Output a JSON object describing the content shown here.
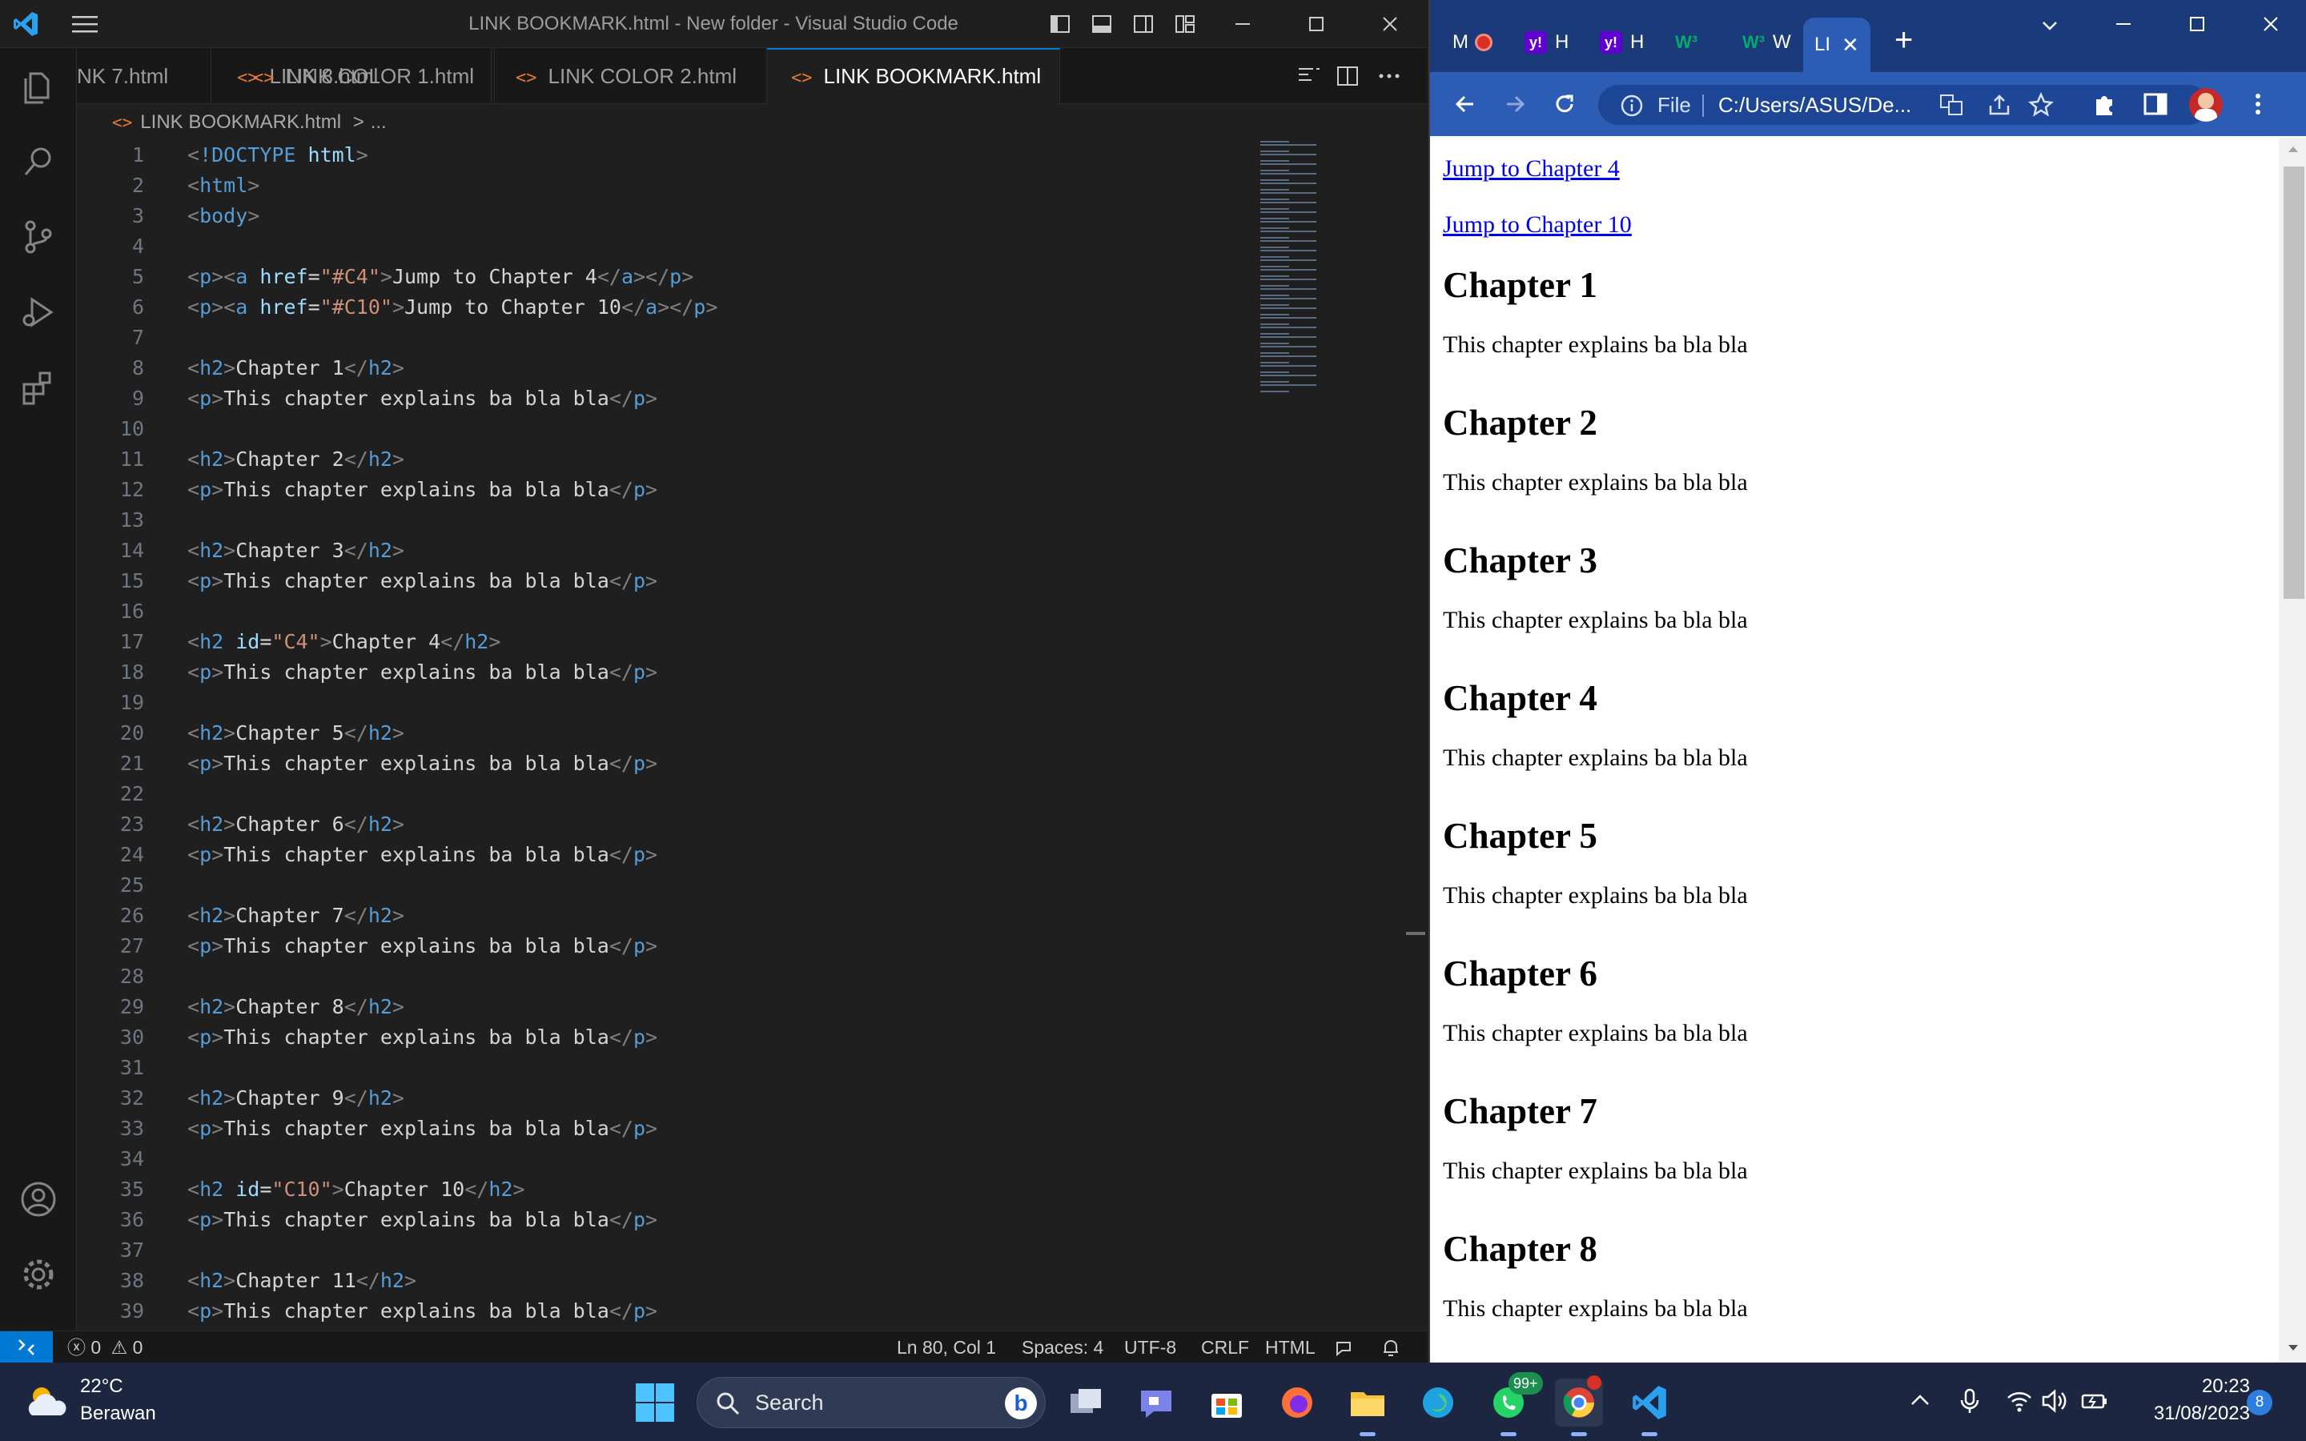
{
  "vscode": {
    "title": "LINK BOOKMARK.html - New folder - Visual Studio Code",
    "tabs": [
      {
        "label": "NK 7.html",
        "icon": "<>"
      },
      {
        "label": "LINK 8.html",
        "icon": "<>"
      },
      {
        "label": "LINK COLOR 1.html",
        "icon": "<>"
      },
      {
        "label": "LINK COLOR 2.html",
        "icon": "<>"
      },
      {
        "label": "LINK BOOKMARK.html",
        "icon": "<>",
        "active": true
      }
    ],
    "breadcrumb": {
      "file": "LINK BOOKMARK.html",
      "separator": ">",
      "rest": "..."
    },
    "code_lines": [
      {
        "n": "1",
        "tokens": [
          [
            "punc",
            "<"
          ],
          [
            "kw",
            "!DOCTYPE "
          ],
          [
            "attr",
            "html"
          ],
          [
            "punc",
            ">"
          ]
        ]
      },
      {
        "n": "2",
        "tokens": [
          [
            "punc",
            "<"
          ],
          [
            "tag",
            "html"
          ],
          [
            "punc",
            ">"
          ]
        ]
      },
      {
        "n": "3",
        "tokens": [
          [
            "punc",
            "<"
          ],
          [
            "tag",
            "body"
          ],
          [
            "punc",
            ">"
          ]
        ]
      },
      {
        "n": "4",
        "tokens": []
      },
      {
        "n": "5",
        "tokens": [
          [
            "punc",
            "<"
          ],
          [
            "tag",
            "p"
          ],
          [
            "punc",
            "><"
          ],
          [
            "tag",
            "a "
          ],
          [
            "attr",
            "href"
          ],
          [
            "text",
            "="
          ],
          [
            "str",
            "\"#C4\""
          ],
          [
            "punc",
            ">"
          ],
          [
            "text",
            "Jump to Chapter 4"
          ],
          [
            "punc",
            "</"
          ],
          [
            "tag",
            "a"
          ],
          [
            "punc",
            "></"
          ],
          [
            "tag",
            "p"
          ],
          [
            "punc",
            ">"
          ]
        ]
      },
      {
        "n": "6",
        "tokens": [
          [
            "punc",
            "<"
          ],
          [
            "tag",
            "p"
          ],
          [
            "punc",
            "><"
          ],
          [
            "tag",
            "a "
          ],
          [
            "attr",
            "href"
          ],
          [
            "text",
            "="
          ],
          [
            "str",
            "\"#C10\""
          ],
          [
            "punc",
            ">"
          ],
          [
            "text",
            "Jump to Chapter 10"
          ],
          [
            "punc",
            "</"
          ],
          [
            "tag",
            "a"
          ],
          [
            "punc",
            "></"
          ],
          [
            "tag",
            "p"
          ],
          [
            "punc",
            ">"
          ]
        ]
      },
      {
        "n": "7",
        "tokens": []
      },
      {
        "n": "8",
        "tokens": [
          [
            "punc",
            "<"
          ],
          [
            "tag",
            "h2"
          ],
          [
            "punc",
            ">"
          ],
          [
            "text",
            "Chapter 1"
          ],
          [
            "punc",
            "</"
          ],
          [
            "tag",
            "h2"
          ],
          [
            "punc",
            ">"
          ]
        ]
      },
      {
        "n": "9",
        "tokens": [
          [
            "punc",
            "<"
          ],
          [
            "tag",
            "p"
          ],
          [
            "punc",
            ">"
          ],
          [
            "text",
            "This chapter explains ba bla bla"
          ],
          [
            "punc",
            "</"
          ],
          [
            "tag",
            "p"
          ],
          [
            "punc",
            ">"
          ]
        ]
      },
      {
        "n": "10",
        "tokens": []
      },
      {
        "n": "11",
        "tokens": [
          [
            "punc",
            "<"
          ],
          [
            "tag",
            "h2"
          ],
          [
            "punc",
            ">"
          ],
          [
            "text",
            "Chapter 2"
          ],
          [
            "punc",
            "</"
          ],
          [
            "tag",
            "h2"
          ],
          [
            "punc",
            ">"
          ]
        ]
      },
      {
        "n": "12",
        "tokens": [
          [
            "punc",
            "<"
          ],
          [
            "tag",
            "p"
          ],
          [
            "punc",
            ">"
          ],
          [
            "text",
            "This chapter explains ba bla bla"
          ],
          [
            "punc",
            "</"
          ],
          [
            "tag",
            "p"
          ],
          [
            "punc",
            ">"
          ]
        ]
      },
      {
        "n": "13",
        "tokens": []
      },
      {
        "n": "14",
        "tokens": [
          [
            "punc",
            "<"
          ],
          [
            "tag",
            "h2"
          ],
          [
            "punc",
            ">"
          ],
          [
            "text",
            "Chapter 3"
          ],
          [
            "punc",
            "</"
          ],
          [
            "tag",
            "h2"
          ],
          [
            "punc",
            ">"
          ]
        ]
      },
      {
        "n": "15",
        "tokens": [
          [
            "punc",
            "<"
          ],
          [
            "tag",
            "p"
          ],
          [
            "punc",
            ">"
          ],
          [
            "text",
            "This chapter explains ba bla bla"
          ],
          [
            "punc",
            "</"
          ],
          [
            "tag",
            "p"
          ],
          [
            "punc",
            ">"
          ]
        ]
      },
      {
        "n": "16",
        "tokens": []
      },
      {
        "n": "17",
        "tokens": [
          [
            "punc",
            "<"
          ],
          [
            "tag",
            "h2 "
          ],
          [
            "attr",
            "id"
          ],
          [
            "text",
            "="
          ],
          [
            "str",
            "\"C4\""
          ],
          [
            "punc",
            ">"
          ],
          [
            "text",
            "Chapter 4"
          ],
          [
            "punc",
            "</"
          ],
          [
            "tag",
            "h2"
          ],
          [
            "punc",
            ">"
          ]
        ]
      },
      {
        "n": "18",
        "tokens": [
          [
            "punc",
            "<"
          ],
          [
            "tag",
            "p"
          ],
          [
            "punc",
            ">"
          ],
          [
            "text",
            "This chapter explains ba bla bla"
          ],
          [
            "punc",
            "</"
          ],
          [
            "tag",
            "p"
          ],
          [
            "punc",
            ">"
          ]
        ]
      },
      {
        "n": "19",
        "tokens": []
      },
      {
        "n": "20",
        "tokens": [
          [
            "punc",
            "<"
          ],
          [
            "tag",
            "h2"
          ],
          [
            "punc",
            ">"
          ],
          [
            "text",
            "Chapter 5"
          ],
          [
            "punc",
            "</"
          ],
          [
            "tag",
            "h2"
          ],
          [
            "punc",
            ">"
          ]
        ]
      },
      {
        "n": "21",
        "tokens": [
          [
            "punc",
            "<"
          ],
          [
            "tag",
            "p"
          ],
          [
            "punc",
            ">"
          ],
          [
            "text",
            "This chapter explains ba bla bla"
          ],
          [
            "punc",
            "</"
          ],
          [
            "tag",
            "p"
          ],
          [
            "punc",
            ">"
          ]
        ]
      },
      {
        "n": "22",
        "tokens": []
      },
      {
        "n": "23",
        "tokens": [
          [
            "punc",
            "<"
          ],
          [
            "tag",
            "h2"
          ],
          [
            "punc",
            ">"
          ],
          [
            "text",
            "Chapter 6"
          ],
          [
            "punc",
            "</"
          ],
          [
            "tag",
            "h2"
          ],
          [
            "punc",
            ">"
          ]
        ]
      },
      {
        "n": "24",
        "tokens": [
          [
            "punc",
            "<"
          ],
          [
            "tag",
            "p"
          ],
          [
            "punc",
            ">"
          ],
          [
            "text",
            "This chapter explains ba bla bla"
          ],
          [
            "punc",
            "</"
          ],
          [
            "tag",
            "p"
          ],
          [
            "punc",
            ">"
          ]
        ]
      },
      {
        "n": "25",
        "tokens": []
      },
      {
        "n": "26",
        "tokens": [
          [
            "punc",
            "<"
          ],
          [
            "tag",
            "h2"
          ],
          [
            "punc",
            ">"
          ],
          [
            "text",
            "Chapter 7"
          ],
          [
            "punc",
            "</"
          ],
          [
            "tag",
            "h2"
          ],
          [
            "punc",
            ">"
          ]
        ]
      },
      {
        "n": "27",
        "tokens": [
          [
            "punc",
            "<"
          ],
          [
            "tag",
            "p"
          ],
          [
            "punc",
            ">"
          ],
          [
            "text",
            "This chapter explains ba bla bla"
          ],
          [
            "punc",
            "</"
          ],
          [
            "tag",
            "p"
          ],
          [
            "punc",
            ">"
          ]
        ]
      },
      {
        "n": "28",
        "tokens": []
      },
      {
        "n": "29",
        "tokens": [
          [
            "punc",
            "<"
          ],
          [
            "tag",
            "h2"
          ],
          [
            "punc",
            ">"
          ],
          [
            "text",
            "Chapter 8"
          ],
          [
            "punc",
            "</"
          ],
          [
            "tag",
            "h2"
          ],
          [
            "punc",
            ">"
          ]
        ]
      },
      {
        "n": "30",
        "tokens": [
          [
            "punc",
            "<"
          ],
          [
            "tag",
            "p"
          ],
          [
            "punc",
            ">"
          ],
          [
            "text",
            "This chapter explains ba bla bla"
          ],
          [
            "punc",
            "</"
          ],
          [
            "tag",
            "p"
          ],
          [
            "punc",
            ">"
          ]
        ]
      },
      {
        "n": "31",
        "tokens": []
      },
      {
        "n": "32",
        "tokens": [
          [
            "punc",
            "<"
          ],
          [
            "tag",
            "h2"
          ],
          [
            "punc",
            ">"
          ],
          [
            "text",
            "Chapter 9"
          ],
          [
            "punc",
            "</"
          ],
          [
            "tag",
            "h2"
          ],
          [
            "punc",
            ">"
          ]
        ]
      },
      {
        "n": "33",
        "tokens": [
          [
            "punc",
            "<"
          ],
          [
            "tag",
            "p"
          ],
          [
            "punc",
            ">"
          ],
          [
            "text",
            "This chapter explains ba bla bla"
          ],
          [
            "punc",
            "</"
          ],
          [
            "tag",
            "p"
          ],
          [
            "punc",
            ">"
          ]
        ]
      },
      {
        "n": "34",
        "tokens": []
      },
      {
        "n": "35",
        "tokens": [
          [
            "punc",
            "<"
          ],
          [
            "tag",
            "h2 "
          ],
          [
            "attr",
            "id"
          ],
          [
            "text",
            "="
          ],
          [
            "str",
            "\"C10\""
          ],
          [
            "punc",
            ">"
          ],
          [
            "text",
            "Chapter 10"
          ],
          [
            "punc",
            "</"
          ],
          [
            "tag",
            "h2"
          ],
          [
            "punc",
            ">"
          ]
        ]
      },
      {
        "n": "36",
        "tokens": [
          [
            "punc",
            "<"
          ],
          [
            "tag",
            "p"
          ],
          [
            "punc",
            ">"
          ],
          [
            "text",
            "This chapter explains ba bla bla"
          ],
          [
            "punc",
            "</"
          ],
          [
            "tag",
            "p"
          ],
          [
            "punc",
            ">"
          ]
        ]
      },
      {
        "n": "37",
        "tokens": []
      },
      {
        "n": "38",
        "tokens": [
          [
            "punc",
            "<"
          ],
          [
            "tag",
            "h2"
          ],
          [
            "punc",
            ">"
          ],
          [
            "text",
            "Chapter 11"
          ],
          [
            "punc",
            "</"
          ],
          [
            "tag",
            "h2"
          ],
          [
            "punc",
            ">"
          ]
        ]
      },
      {
        "n": "39",
        "tokens": [
          [
            "punc",
            "<"
          ],
          [
            "tag",
            "p"
          ],
          [
            "punc",
            ">"
          ],
          [
            "text",
            "This chapter explains ba bla bla"
          ],
          [
            "punc",
            "</"
          ],
          [
            "tag",
            "p"
          ],
          [
            "punc",
            ">"
          ]
        ]
      }
    ],
    "status": {
      "errors": "0",
      "warnings": "0",
      "position": "Ln 80, Col 1",
      "spaces": "Spaces: 4",
      "encoding": "UTF-8",
      "eol": "CRLF",
      "language": "HTML"
    },
    "colors": {
      "accent": "#0078d4",
      "tag": "#569cd6",
      "attr": "#9cdcfe",
      "string": "#ce9178"
    }
  },
  "chrome": {
    "tabs": [
      {
        "label": "M",
        "icon": "gmail"
      },
      {
        "label": "H",
        "icon": "yahoo"
      },
      {
        "label": "H",
        "icon": "yahoo"
      },
      {
        "label": "",
        "icon": "w3schools"
      },
      {
        "label": "W",
        "icon": "w3schools"
      },
      {
        "label": "LI",
        "icon": "page",
        "active": true
      }
    ],
    "address": {
      "scheme_label": "File",
      "url": "C:/Users/ASUS/De..."
    },
    "page": {
      "links": [
        "Jump to Chapter 4",
        "Jump to Chapter 10"
      ],
      "sections": [
        {
          "heading": "Chapter 1",
          "text": "This chapter explains ba bla bla"
        },
        {
          "heading": "Chapter 2",
          "text": "This chapter explains ba bla bla"
        },
        {
          "heading": "Chapter 3",
          "text": "This chapter explains ba bla bla"
        },
        {
          "heading": "Chapter 4",
          "text": "This chapter explains ba bla bla"
        },
        {
          "heading": "Chapter 5",
          "text": "This chapter explains ba bla bla"
        },
        {
          "heading": "Chapter 6",
          "text": "This chapter explains ba bla bla"
        },
        {
          "heading": "Chapter 7",
          "text": "This chapter explains ba bla bla"
        },
        {
          "heading": "Chapter 8",
          "text": "This chapter explains ba bla bla"
        }
      ]
    },
    "colors": {
      "frame": "#1b3a7a",
      "toolbar": "#2d5cb5",
      "link": "#0000ee"
    }
  },
  "taskbar": {
    "weather": {
      "temp": "22°C",
      "condition": "Berawan"
    },
    "search_placeholder": "Search",
    "whatsapp_badge": "99+",
    "time": "20:23",
    "date": "31/08/2023",
    "notifications": "8"
  }
}
